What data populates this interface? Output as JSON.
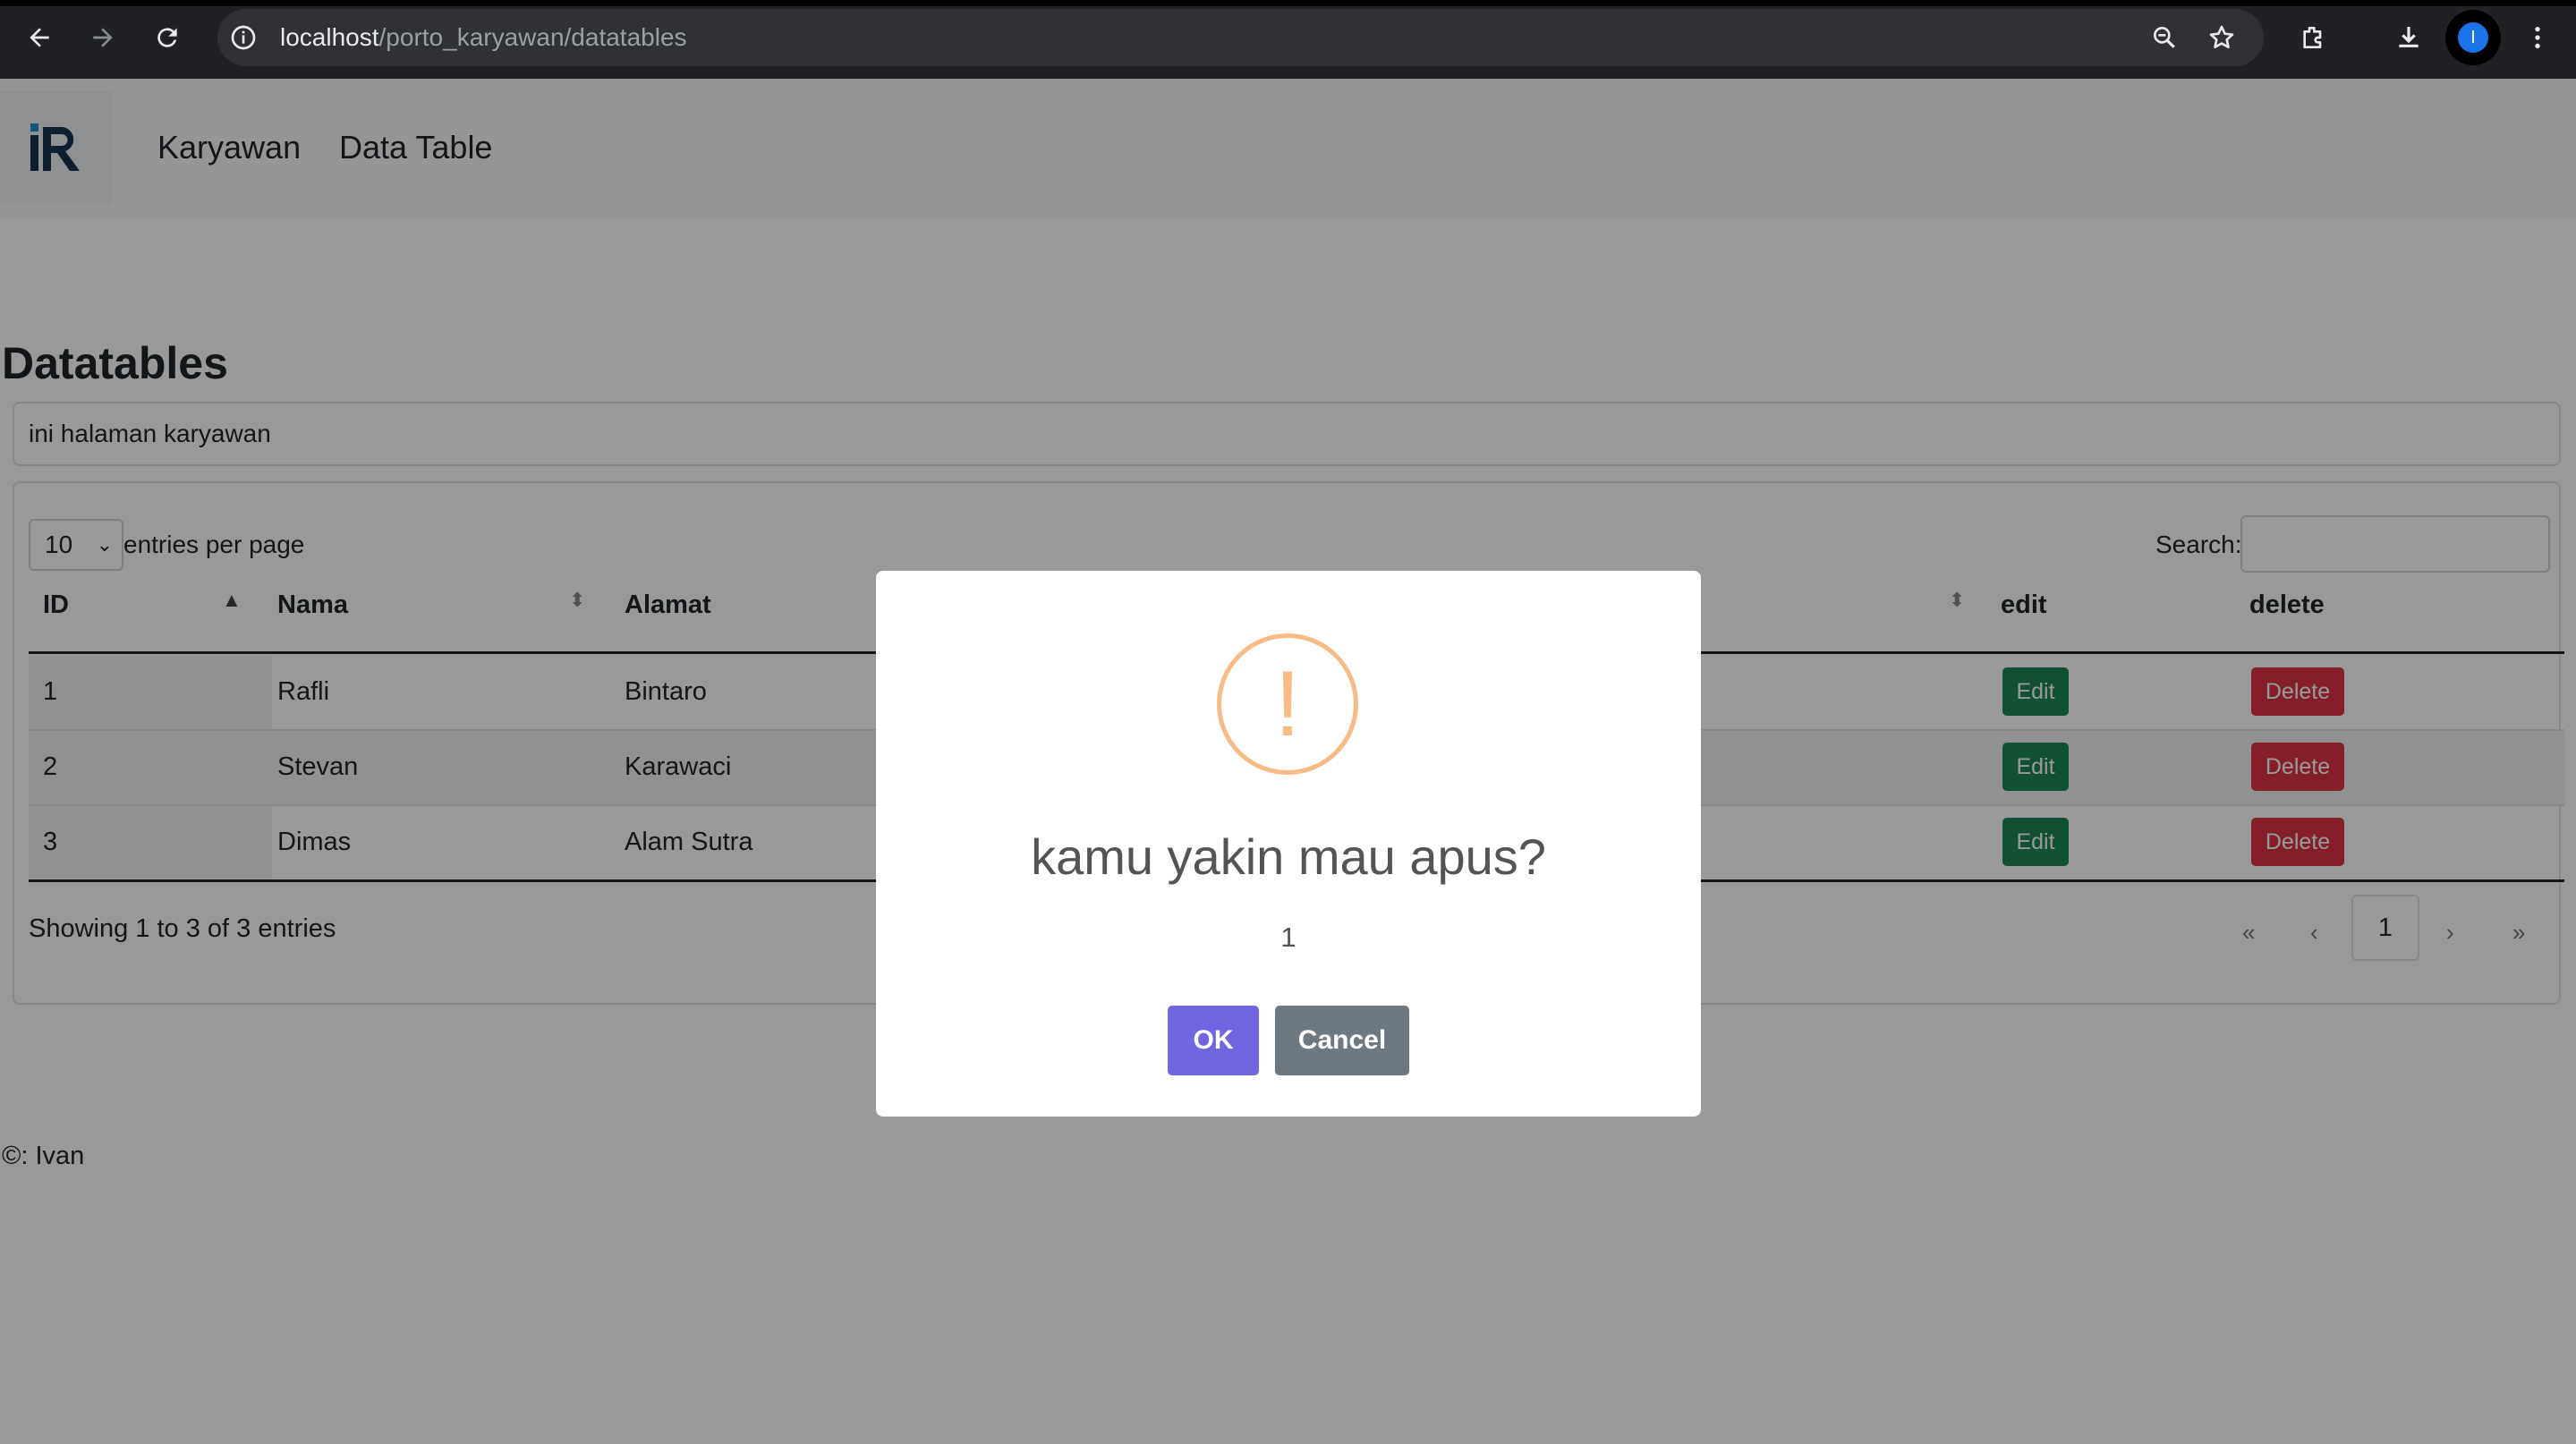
{
  "browser": {
    "url_host": "localhost",
    "url_path": "/porto_karyawan/datatables",
    "profile_initial": "I"
  },
  "navbar": {
    "links": [
      "Karyawan",
      "Data Table"
    ]
  },
  "page": {
    "heading": "Datatables",
    "subtitle": "ini halaman karyawan"
  },
  "datatable": {
    "page_size": "10",
    "entries_label": "entries per page",
    "search_label": "Search:",
    "columns": [
      "ID",
      "Nama",
      "Alamat",
      "edit",
      "delete"
    ],
    "rows": [
      {
        "id": "1",
        "nama": "Rafli",
        "alamat": "Bintaro"
      },
      {
        "id": "2",
        "nama": "Stevan",
        "alamat": "Karawaci"
      },
      {
        "id": "3",
        "nama": "Dimas",
        "alamat": "Alam Sutra"
      }
    ],
    "edit_label": "Edit",
    "delete_label": "Delete",
    "info": "Showing 1 to 3 of 3 entries",
    "pagination": {
      "first": "«",
      "prev": "‹",
      "current": "1",
      "next": "›",
      "last": "»"
    }
  },
  "footer": {
    "text": "©: Ivan"
  },
  "dialog": {
    "icon": "!",
    "title": "kamu yakin mau apus?",
    "text": "1",
    "ok_label": "OK",
    "cancel_label": "Cancel"
  },
  "colors": {
    "edit": "#198754",
    "delete": "#dc3545",
    "confirm": "#7066e0",
    "cancel": "#6e7881",
    "warning_icon": "#f8bb86"
  }
}
